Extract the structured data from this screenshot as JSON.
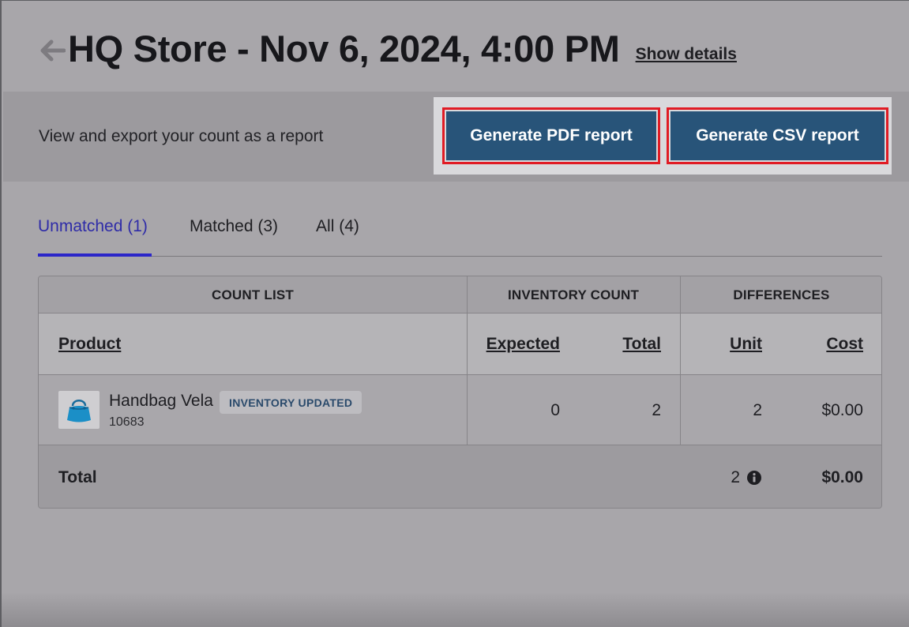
{
  "header": {
    "title": "HQ Store - Nov 6, 2024, 4:00 PM",
    "show_details": "Show details",
    "back_icon": "arrow-left-icon"
  },
  "report": {
    "description": "View and export your count as a report",
    "pdf_button": "Generate PDF report",
    "csv_button": "Generate CSV report"
  },
  "tabs": [
    {
      "label": "Unmatched (1)",
      "active": true
    },
    {
      "label": "Matched (3)",
      "active": false
    },
    {
      "label": "All (4)",
      "active": false
    }
  ],
  "table": {
    "groups": {
      "count_list": "COUNT LIST",
      "inventory_count": "INVENTORY COUNT",
      "differences": "DIFFERENCES"
    },
    "columns": {
      "product": "Product",
      "expected": "Expected",
      "total": "Total",
      "unit": "Unit",
      "cost": "Cost"
    },
    "rows": [
      {
        "product_name": "Handbag Vela",
        "badge": "INVENTORY UPDATED",
        "sku": "10683",
        "expected": "0",
        "total": "2",
        "unit": "2",
        "cost": "$0.00",
        "thumbnail_icon": "handbag-icon"
      }
    ],
    "footer": {
      "label": "Total",
      "unit": "2",
      "cost": "$0.00",
      "info_icon": "info-icon"
    }
  },
  "colors": {
    "button_bg": "#285479",
    "highlight_outline": "#e01b24",
    "active_tab": "#2b26c9",
    "badge_text": "#2a4a6b"
  }
}
